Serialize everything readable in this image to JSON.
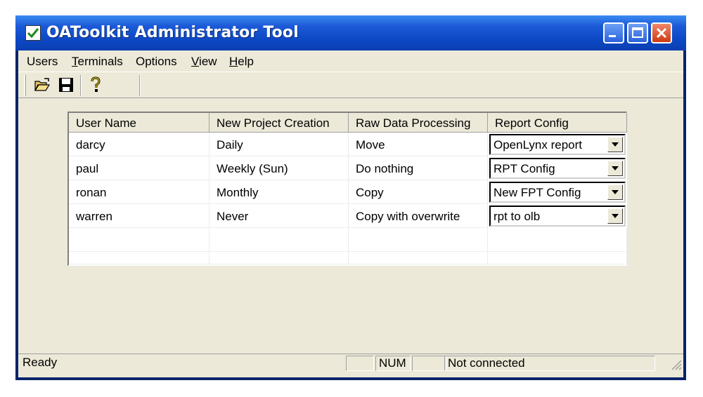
{
  "window": {
    "title": "OAToolkit Administrator Tool"
  },
  "menubar": {
    "items": [
      {
        "label": "Users",
        "underline": ""
      },
      {
        "label": "Terminals",
        "underline": "T"
      },
      {
        "label": "Options",
        "underline": ""
      },
      {
        "label": "View",
        "underline": "V"
      },
      {
        "label": "Help",
        "underline": "H"
      }
    ]
  },
  "toolbar": {
    "buttons": [
      {
        "name": "open-folder-icon"
      },
      {
        "name": "save-disk-icon"
      },
      {
        "name": "help-question-icon"
      }
    ]
  },
  "grid": {
    "columns": [
      "User Name",
      "New Project Creation",
      "Raw Data Processing",
      "Report Config"
    ],
    "rows": [
      {
        "user": "darcy",
        "creation": "Daily",
        "processing": "Move",
        "report": "OpenLynx report"
      },
      {
        "user": "paul",
        "creation": "Weekly (Sun)",
        "processing": "Do nothing",
        "report": "RPT Config"
      },
      {
        "user": "ronan",
        "creation": "Monthly",
        "processing": "Copy",
        "report": "New FPT Config"
      },
      {
        "user": "warren",
        "creation": "Never",
        "processing": "Copy with overwrite",
        "report": "rpt to olb"
      }
    ]
  },
  "statusbar": {
    "ready": "Ready",
    "num": "NUM",
    "connection": "Not connected"
  },
  "colors": {
    "titlebar": "#0d47c4",
    "face": "#ece9d8",
    "close": "#cf3a12"
  }
}
